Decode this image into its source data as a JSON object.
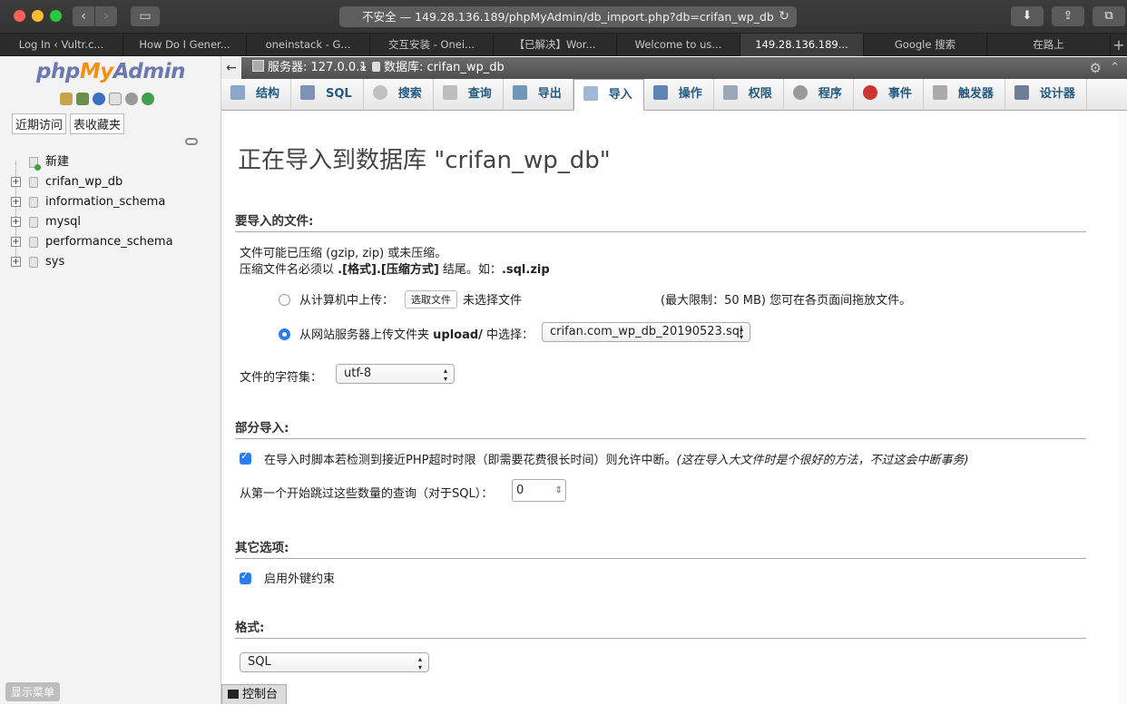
{
  "browser": {
    "url": "不安全 — 149.28.136.189/phpMyAdmin/db_import.php?db=crifan_wp_db",
    "tabs": [
      {
        "label": "Log In ‹ Vultr.c..."
      },
      {
        "label": "How Do I Gener..."
      },
      {
        "label": "oneinstack - G..."
      },
      {
        "label": "交互安装 - Onei..."
      },
      {
        "label": "【已解决】Wor..."
      },
      {
        "label": "Welcome to us..."
      },
      {
        "label": "149.28.136.189..."
      },
      {
        "label": "Google 搜索"
      },
      {
        "label": "在路上"
      }
    ],
    "active_tab_index": 6,
    "new_tab": "+"
  },
  "sidebar": {
    "logo": {
      "php": "php",
      "my": "My",
      "admin": "Admin"
    },
    "buttons": {
      "recent": "近期访问",
      "favorites": "表收藏夹"
    },
    "tree": [
      {
        "label": "新建"
      },
      {
        "label": "crifan_wp_db"
      },
      {
        "label": "information_schema"
      },
      {
        "label": "mysql"
      },
      {
        "label": "performance_schema"
      },
      {
        "label": "sys"
      }
    ],
    "show_menu": "显示菜单"
  },
  "breadcrumb": {
    "server": "服务器: 127.0.0.1",
    "separator": "»",
    "database": "数据库: crifan_wp_db"
  },
  "tabs": [
    {
      "label": "结构",
      "icon": "structure-icon"
    },
    {
      "label": "SQL",
      "icon": "sql-icon"
    },
    {
      "label": "搜索",
      "icon": "search-icon"
    },
    {
      "label": "查询",
      "icon": "query-icon"
    },
    {
      "label": "导出",
      "icon": "export-icon"
    },
    {
      "label": "导入",
      "icon": "import-icon"
    },
    {
      "label": "操作",
      "icon": "wrench-icon"
    },
    {
      "label": "权限",
      "icon": "privileges-icon"
    },
    {
      "label": "程序",
      "icon": "routines-icon"
    },
    {
      "label": "事件",
      "icon": "clock-icon"
    },
    {
      "label": "触发器",
      "icon": "triggers-icon"
    },
    {
      "label": "设计器",
      "icon": "designer-icon"
    }
  ],
  "active_tab": "导入",
  "page": {
    "title": "正在导入到数据库 \"crifan_wp_db\"",
    "file_section": {
      "heading": "要导入的文件:",
      "note_line1": "文件可能已压缩 (gzip, zip) 或未压缩。",
      "note_line2_prefix": "压缩文件名必须以 ",
      "note_line2_bold": ".[格式].[压缩方式]",
      "note_line2_mid": " 结尾。如：",
      "note_line2_example": ".sql.zip",
      "upload_local_label": "从计算机中上传：",
      "choose_file_button": "选取文件",
      "no_file_text": "未选择文件",
      "limit_text": "(最大限制：50 MB) 您可在各页面间拖放文件。",
      "upload_server_prefix": "从网站服务器上传文件夹 ",
      "upload_server_dir": "upload/",
      "upload_server_suffix": " 中选择：",
      "server_file_selected": "crifan.com_wp_db_20190523.sql",
      "charset_label": "文件的字符集：",
      "charset_selected": "utf-8"
    },
    "partial_section": {
      "heading": "部分导入:",
      "allow_interrupt_label": "在导入时脚本若检测到接近PHP超时时限（即需要花费很长时间）则允许中断。",
      "allow_interrupt_hint": "(这在导入大文件时是个很好的方法，不过这会中断事务)",
      "allow_interrupt_checked": true,
      "skip_label": "从第一个开始跳过这些数量的查询（对于SQL）：",
      "skip_value": "0"
    },
    "other_section": {
      "heading": "其它选项:",
      "fk_label": "启用外键约束",
      "fk_checked": true
    },
    "format_section": {
      "heading": "格式:",
      "format_selected": "SQL"
    }
  },
  "console": {
    "label": "控制台"
  },
  "colors": {
    "accent": "#2a7cf0",
    "tab_text": "#235a81"
  }
}
